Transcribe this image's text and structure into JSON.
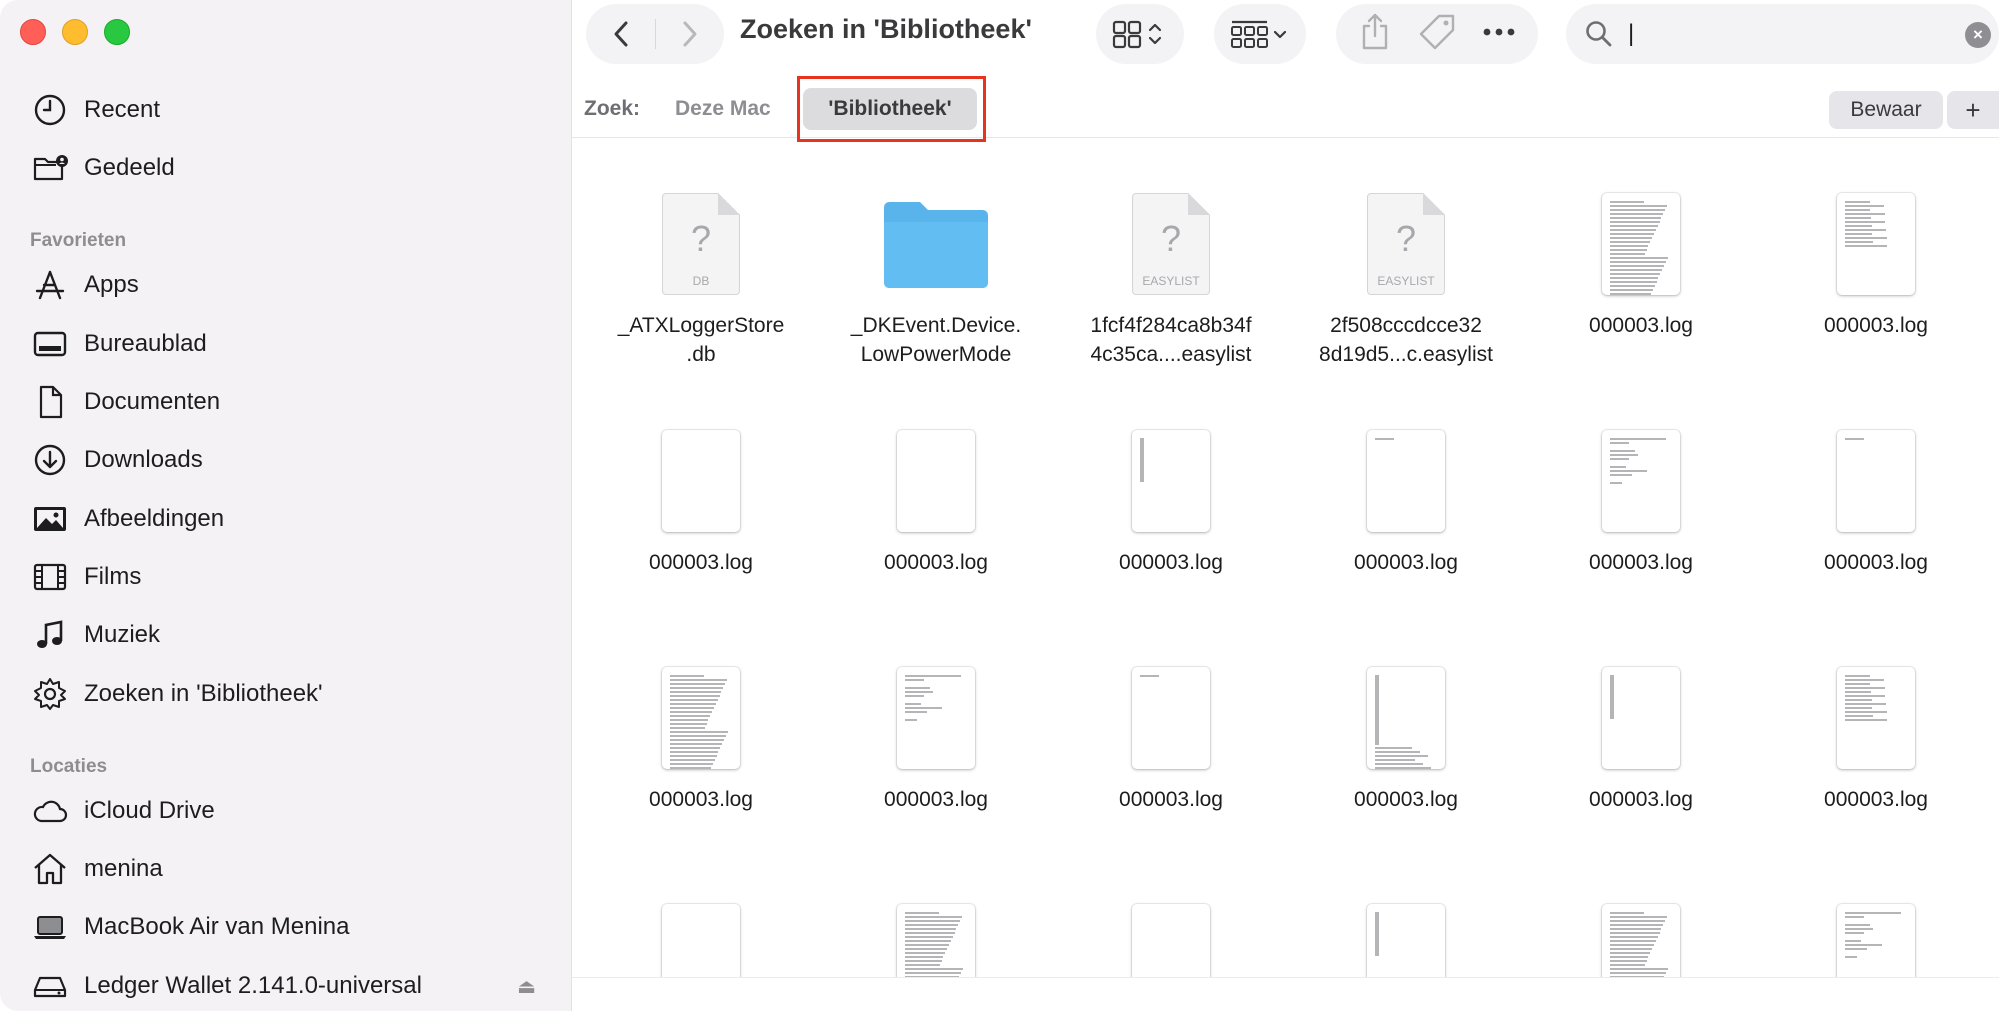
{
  "window": {
    "title": "Zoeken in 'Bibliotheek'"
  },
  "sidebar": {
    "top_items": [
      {
        "label": "Recent",
        "icon": "clock-icon"
      },
      {
        "label": "Gedeeld",
        "icon": "shared-folder-icon"
      }
    ],
    "favorites_title": "Favorieten",
    "favorites": [
      {
        "label": "Apps",
        "icon": "apps-icon"
      },
      {
        "label": "Bureaublad",
        "icon": "desktop-icon"
      },
      {
        "label": "Documenten",
        "icon": "document-icon"
      },
      {
        "label": "Downloads",
        "icon": "download-icon"
      },
      {
        "label": "Afbeeldingen",
        "icon": "photo-icon"
      },
      {
        "label": "Films",
        "icon": "film-icon"
      },
      {
        "label": "Muziek",
        "icon": "music-icon"
      },
      {
        "label": "Zoeken in 'Bibliotheek'",
        "icon": "gear-icon"
      }
    ],
    "locations_title": "Locaties",
    "locations": [
      {
        "label": "iCloud Drive",
        "icon": "cloud-icon"
      },
      {
        "label": "menina",
        "icon": "home-icon"
      },
      {
        "label": "MacBook Air van Menina",
        "icon": "laptop-icon"
      },
      {
        "label": "Ledger Wallet 2.141.0-universal",
        "icon": "disk-icon"
      }
    ],
    "eject_symbol": "⏏"
  },
  "toolbar": {
    "back_icon": "chevron-left-icon",
    "forward_icon": "chevron-right-icon",
    "view_icon": "icon-grid-icon",
    "group_icon": "group-icon",
    "share_icon": "share-icon",
    "tag_icon": "tag-icon",
    "more_icon": "ellipsis-icon",
    "search": {
      "value": "",
      "cursor": "|",
      "clear_symbol": "×"
    }
  },
  "scope": {
    "label": "Zoek:",
    "this_mac": "Deze Mac",
    "library": "'Bibliotheek'",
    "save": "Bewaar",
    "add": "+"
  },
  "colors": {
    "highlight": "#e8331f",
    "folder": "#5ab4ec",
    "sidebar_bg": "#f4f2f4"
  },
  "files": [
    {
      "name": "_ATXLoggerStore\n.db",
      "kind": "generic",
      "ext": "DB"
    },
    {
      "name": "_DKEvent.Device.\nLowPowerMode",
      "kind": "folder"
    },
    {
      "name": "1fcf4f284ca8b34f\n4c35ca....easylist",
      "kind": "generic",
      "ext": "EASYLIST"
    },
    {
      "name": "2f508cccdcce32\n8d19d5...c.easylist",
      "kind": "generic",
      "ext": "EASYLIST"
    },
    {
      "name": "000003.log",
      "kind": "doc",
      "density": "dense"
    },
    {
      "name": "000003.log",
      "kind": "doc",
      "density": "medium"
    },
    {
      "name": "000003.log",
      "kind": "doc",
      "density": "empty"
    },
    {
      "name": "000003.log",
      "kind": "doc",
      "density": "empty"
    },
    {
      "name": "000003.log",
      "kind": "doc",
      "density": "bar"
    },
    {
      "name": "000003.log",
      "kind": "doc",
      "density": "tiny"
    },
    {
      "name": "000003.log",
      "kind": "doc",
      "density": "sparse"
    },
    {
      "name": "000003.log",
      "kind": "doc",
      "density": "tiny"
    },
    {
      "name": "000003.log",
      "kind": "doc",
      "density": "dense"
    },
    {
      "name": "000003.log",
      "kind": "doc",
      "density": "sparse"
    },
    {
      "name": "000003.log",
      "kind": "doc",
      "density": "tiny"
    },
    {
      "name": "000003.log",
      "kind": "doc",
      "density": "bottom"
    },
    {
      "name": "000003.log",
      "kind": "doc",
      "density": "bar"
    },
    {
      "name": "000003.log",
      "kind": "doc",
      "density": "medium"
    },
    {
      "name": "",
      "kind": "doc",
      "density": "empty"
    },
    {
      "name": "",
      "kind": "doc",
      "density": "dense"
    },
    {
      "name": "",
      "kind": "doc",
      "density": "empty"
    },
    {
      "name": "",
      "kind": "doc",
      "density": "bar"
    },
    {
      "name": "",
      "kind": "doc",
      "density": "dense"
    },
    {
      "name": "",
      "kind": "doc",
      "density": "sparse"
    }
  ]
}
